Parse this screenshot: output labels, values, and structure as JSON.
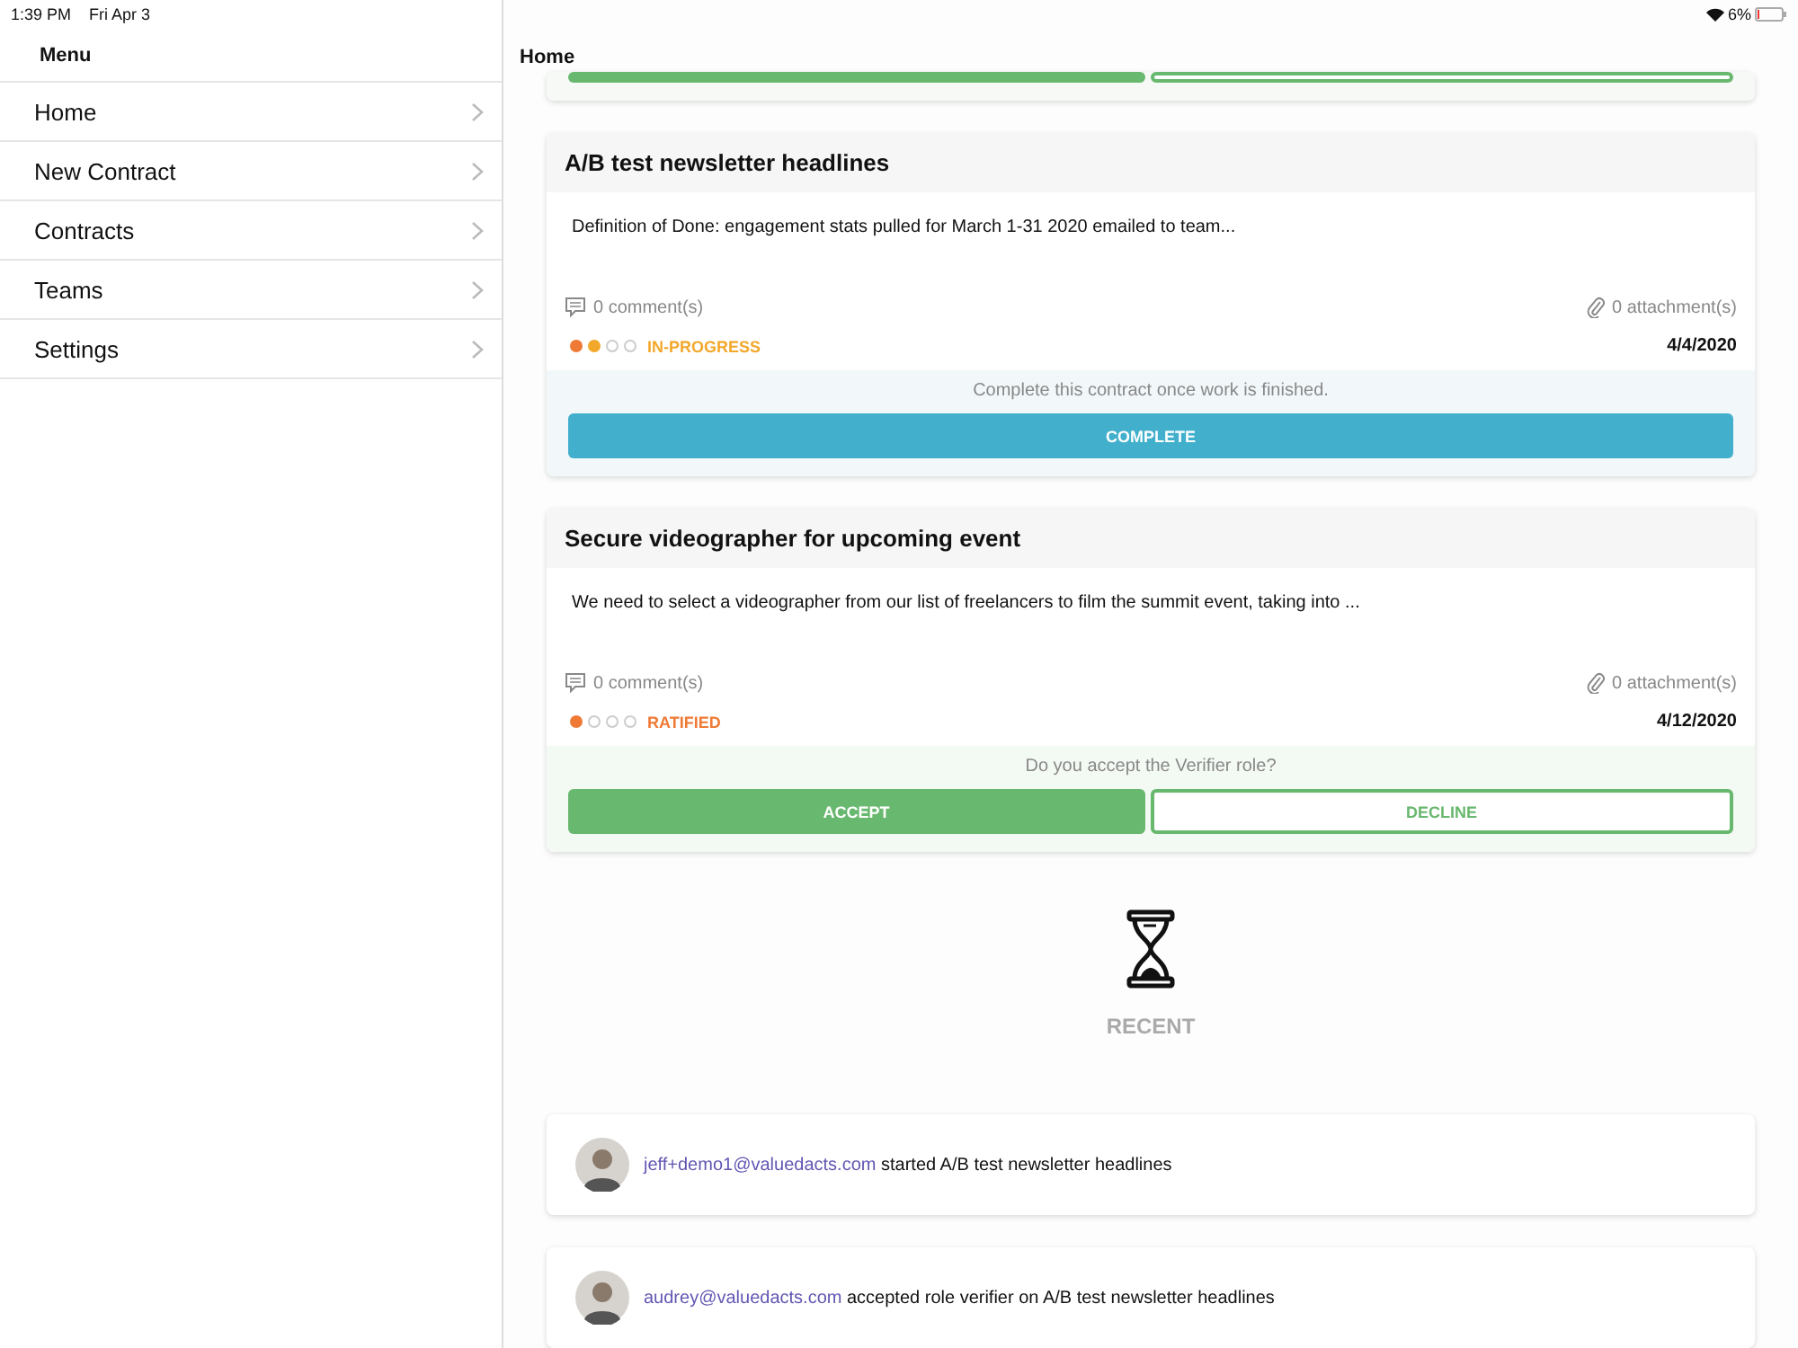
{
  "status_bar": {
    "time": "1:39 PM",
    "date": "Fri Apr 3",
    "battery": "6%"
  },
  "sidebar": {
    "title": "Menu",
    "items": [
      {
        "label": "Home"
      },
      {
        "label": "New Contract"
      },
      {
        "label": "Contracts"
      },
      {
        "label": "Teams"
      },
      {
        "label": "Settings"
      }
    ]
  },
  "main": {
    "title": "Home",
    "cards": [
      {
        "kind": "stub",
        "actions": {
          "kind": "accept_decline",
          "buttons": [
            {
              "kind": "solid"
            },
            {
              "kind": "outline"
            }
          ]
        }
      },
      {
        "kind": "contract",
        "title": "A/B test newsletter headlines",
        "description": "Definition of Done: engagement stats pulled for March 1-31 2020 emailed to team...",
        "comments": "0 comment(s)",
        "attachments": "0 attachment(s)",
        "dots": [
          {
            "filled": true,
            "color": "#ef7a35"
          },
          {
            "filled": true,
            "color": "#f2a82b"
          },
          {
            "filled": false
          },
          {
            "filled": false
          }
        ],
        "status": {
          "label": "IN-PROGRESS",
          "color": "#f2a82b"
        },
        "date": "4/4/2020",
        "actions": {
          "kind": "complete",
          "prompt": "Complete this contract once work is finished.",
          "buttons": [
            {
              "kind": "info",
              "label": "COMPLETE"
            }
          ]
        }
      },
      {
        "kind": "contract",
        "title": "Secure videographer for upcoming event",
        "description": "We need to select a videographer from our list of freelancers to film the summit event, taking into ...",
        "comments": "0 comment(s)",
        "attachments": "0 attachment(s)",
        "dots": [
          {
            "filled": true,
            "color": "#ef7a35"
          },
          {
            "filled": false
          },
          {
            "filled": false
          },
          {
            "filled": false
          }
        ],
        "status": {
          "label": "RATIFIED",
          "color": "#ef7a35"
        },
        "date": "4/12/2020",
        "actions": {
          "kind": "accept_decline",
          "prompt": "Do you accept the Verifier role?",
          "buttons": [
            {
              "kind": "solid",
              "label": "ACCEPT"
            },
            {
              "kind": "outline",
              "label": "DECLINE"
            }
          ]
        }
      }
    ],
    "recent": {
      "title": "RECENT",
      "items": [
        {
          "actor": "jeff+demo1@valuedacts.com",
          "text": "started A/B test newsletter headlines"
        },
        {
          "actor": "audrey@valuedacts.com",
          "text": "accepted role verifier on A/B test newsletter headlines"
        }
      ]
    }
  }
}
